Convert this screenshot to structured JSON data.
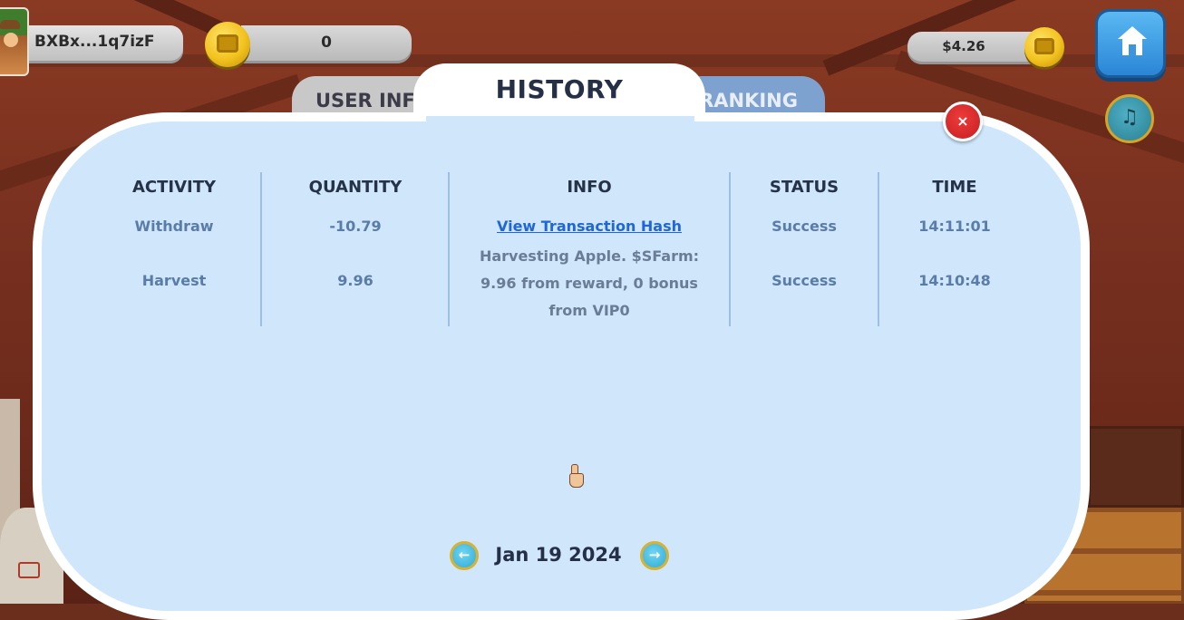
{
  "hud": {
    "wallet_address": "BXBx...1q7izF",
    "token_balance": "0",
    "usd_balance": "$4.26",
    "home_icon": "home-icon",
    "music_icon": "music-note-icon",
    "coin_icon": "farm-coin-icon"
  },
  "tabs": [
    {
      "label": "USER INFO",
      "active": false
    },
    {
      "label": "HISTORY",
      "active": true
    },
    {
      "label": "RANKING",
      "active": false
    }
  ],
  "modal": {
    "title": "HISTORY",
    "close_label": "×"
  },
  "table": {
    "headers": [
      "ACTIVITY",
      "QUANTITY",
      "INFO",
      "STATUS",
      "TIME"
    ],
    "rows": [
      {
        "activity": "Withdraw",
        "quantity": "-10.79",
        "info": "View Transaction Hash",
        "status": "Success",
        "time": "14:11:01"
      },
      {
        "activity": "Harvest",
        "quantity": "9.96",
        "info": "Harvesting Apple. $SFarm: 9.96 from reward, 0 bonus from VIP0",
        "status": "Success",
        "time": "14:10:48"
      }
    ]
  },
  "pager": {
    "date": "Jan 19 2024",
    "prev_label": "←",
    "next_label": "→"
  },
  "colors": {
    "panel_bg": "#cfe6fb",
    "link": "#1f67d8",
    "close_red": "#d62a2c",
    "home_blue": "#3a98e2"
  }
}
